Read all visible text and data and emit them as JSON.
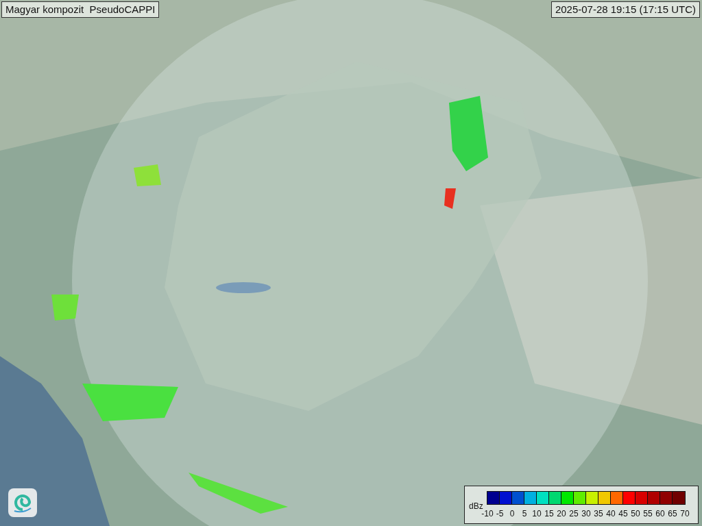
{
  "title": "Magyar kompozit  PseudoCAPPI",
  "timestamp": "2025-07-28 19:15 (17:15 UTC)",
  "legend": {
    "unit": "dBz",
    "bins": [
      {
        "color": "#000090"
      },
      {
        "color": "#0010d0"
      },
      {
        "color": "#0050d0"
      },
      {
        "color": "#00b0e0"
      },
      {
        "color": "#00e0c0"
      },
      {
        "color": "#00d870"
      },
      {
        "color": "#00e800"
      },
      {
        "color": "#60ec00"
      },
      {
        "color": "#c8f000"
      },
      {
        "color": "#f0c800"
      },
      {
        "color": "#ff6800"
      },
      {
        "color": "#ff0000"
      },
      {
        "color": "#d80000"
      },
      {
        "color": "#b00000"
      },
      {
        "color": "#900000"
      },
      {
        "color": "#700000"
      }
    ],
    "ticks": [
      "-10",
      "-5",
      "0",
      "5",
      "10",
      "15",
      "20",
      "25",
      "30",
      "35",
      "40",
      "45",
      "50",
      "55",
      "60",
      "65",
      "70"
    ]
  }
}
